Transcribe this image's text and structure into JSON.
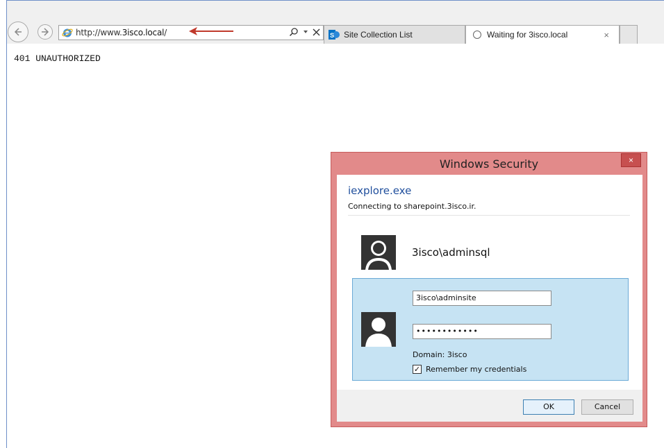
{
  "browser": {
    "url_prefix": "http://www.",
    "url_host": "3isco.local",
    "url_suffix": "/",
    "tabs": [
      {
        "label": "Site Collection List"
      },
      {
        "label": "Waiting for 3isco.local"
      }
    ],
    "tab_close": "×"
  },
  "page": {
    "status_text": "401 UNAUTHORIZED"
  },
  "dialog": {
    "title": "Windows Security",
    "close_label": "×",
    "app_name": "iexplore.exe",
    "subtitle": "Connecting to sharepoint.3isco.ir.",
    "saved_account": "3isco\\adminsql",
    "username_value": "3isco\\adminsite",
    "password_mask": "••••••••••••",
    "domain_text": "Domain: 3isco",
    "remember_label": "Remember my credentials",
    "remember_checked": true,
    "ok_label": "OK",
    "cancel_label": "Cancel"
  },
  "colors": {
    "dialog_frame": "#e28a8a",
    "arrow": "#c0392b",
    "panel": "#c6e3f3",
    "link_blue": "#1f4e9c"
  }
}
